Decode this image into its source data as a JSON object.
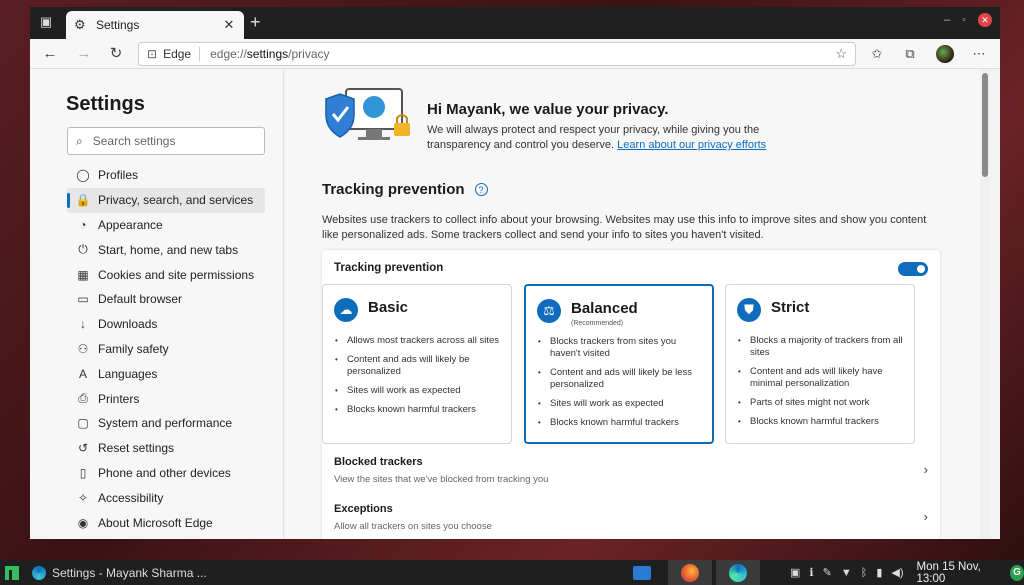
{
  "tab": {
    "title": "Settings"
  },
  "address": {
    "site_label": "Edge",
    "url_prefix": "edge://",
    "url_bold": "settings",
    "url_suffix": "/privacy"
  },
  "sidebar": {
    "title": "Settings",
    "search_placeholder": "Search settings",
    "items": [
      {
        "label": "Profiles",
        "icon": "person-icon",
        "glyph": "◯"
      },
      {
        "label": "Privacy, search, and services",
        "icon": "lock-icon",
        "glyph": "🔒",
        "active": true
      },
      {
        "label": "Appearance",
        "icon": "appearance-icon",
        "glyph": "◔"
      },
      {
        "label": "Start, home, and new tabs",
        "icon": "power-icon",
        "glyph": "⏻"
      },
      {
        "label": "Cookies and site permissions",
        "icon": "cookies-icon",
        "glyph": "▦"
      },
      {
        "label": "Default browser",
        "icon": "browser-icon",
        "glyph": "▭"
      },
      {
        "label": "Downloads",
        "icon": "download-icon",
        "glyph": "↓"
      },
      {
        "label": "Family safety",
        "icon": "family-icon",
        "glyph": "⚇"
      },
      {
        "label": "Languages",
        "icon": "languages-icon",
        "glyph": "A"
      },
      {
        "label": "Printers",
        "icon": "printer-icon",
        "glyph": "⎙"
      },
      {
        "label": "System and performance",
        "icon": "system-icon",
        "glyph": "▢"
      },
      {
        "label": "Reset settings",
        "icon": "reset-icon",
        "glyph": "↺"
      },
      {
        "label": "Phone and other devices",
        "icon": "phone-icon",
        "glyph": "▯"
      },
      {
        "label": "Accessibility",
        "icon": "accessibility-icon",
        "glyph": "✧"
      },
      {
        "label": "About Microsoft Edge",
        "icon": "edge-icon",
        "glyph": "◉"
      }
    ]
  },
  "hero": {
    "title": "Hi Mayank, we value your privacy.",
    "text": "We will always protect and respect your privacy, while giving you the transparency and control you deserve.",
    "link": "Learn about our privacy efforts"
  },
  "tracking": {
    "heading": "Tracking prevention",
    "description": "Websites use trackers to collect info about your browsing. Websites may use this info to improve sites and show you content like personalized ads. Some trackers collect and send your info to sites you haven't visited.",
    "card_title": "Tracking prevention",
    "enabled": true,
    "options": [
      {
        "name": "Basic",
        "recommended": "",
        "icon": "basic-icon",
        "selected": false,
        "bullets": [
          "Allows most trackers across all sites",
          "Content and ads will likely be personalized",
          "Sites will work as expected",
          "Blocks known harmful trackers"
        ]
      },
      {
        "name": "Balanced",
        "recommended": "(Recommended)",
        "icon": "balanced-icon",
        "selected": true,
        "bullets": [
          "Blocks trackers from sites you haven't visited",
          "Content and ads will likely be less personalized",
          "Sites will work as expected",
          "Blocks known harmful trackers"
        ]
      },
      {
        "name": "Strict",
        "recommended": "",
        "icon": "strict-icon",
        "selected": false,
        "bullets": [
          "Blocks a majority of trackers from all sites",
          "Content and ads will likely have minimal personalization",
          "Parts of sites might not work",
          "Blocks known harmful trackers"
        ]
      }
    ],
    "blocked": {
      "title": "Blocked trackers",
      "subtitle": "View the sites that we've blocked from tracking you"
    },
    "exceptions": {
      "title": "Exceptions",
      "subtitle": "Allow all trackers on sites you choose"
    }
  },
  "taskbar": {
    "app_title": "Settings - Mayank Sharma ...",
    "clock": "Mon 15 Nov, 13:00",
    "g_badge": "G"
  },
  "colors": {
    "accent": "#0f6cbd",
    "titlebar": "#202020",
    "close": "#e0434b"
  }
}
